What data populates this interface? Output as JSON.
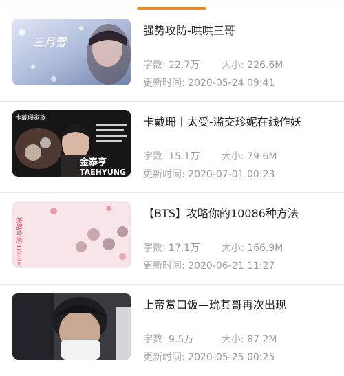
{
  "labels": {
    "words": "字数:",
    "size": "大小:",
    "updated": "更新时间:"
  },
  "books": [
    {
      "title": "强势攻防-哄哄三哥",
      "words": "22.7万",
      "size": "226.6M",
      "updated": "2020-05-24 09:41",
      "cover_text": "三月雪",
      "cover_colors": [
        "#c9d3ec",
        "#8fa3c9"
      ]
    },
    {
      "title": "卡戴珊丨太受-滥交珍妮在线作妖",
      "words": "15.1万",
      "size": "79.6M",
      "updated": "2020-07-01 00:23",
      "cover_text": "卡戴珊家族",
      "cover_subtext": "金泰亨",
      "cover_name": "TAEHYUNG",
      "cover_colors": [
        "#1a1a1a",
        "#3a2a2a"
      ]
    },
    {
      "title": "【BTS】攻略你的10086种方法",
      "words": "17.1万",
      "size": "166.9M",
      "updated": "2020-06-21 11:27",
      "cover_text": "攻略你的10086",
      "cover_colors": [
        "#f4d4da",
        "#e9a8b4"
      ]
    },
    {
      "title": "上帝赏口饭—玧其哥再次出现",
      "words": "9.5万",
      "size": "87.2M",
      "updated": "2020-05-25 00:25",
      "cover_colors": [
        "#2a2a2e",
        "#d8d8dc"
      ]
    }
  ]
}
